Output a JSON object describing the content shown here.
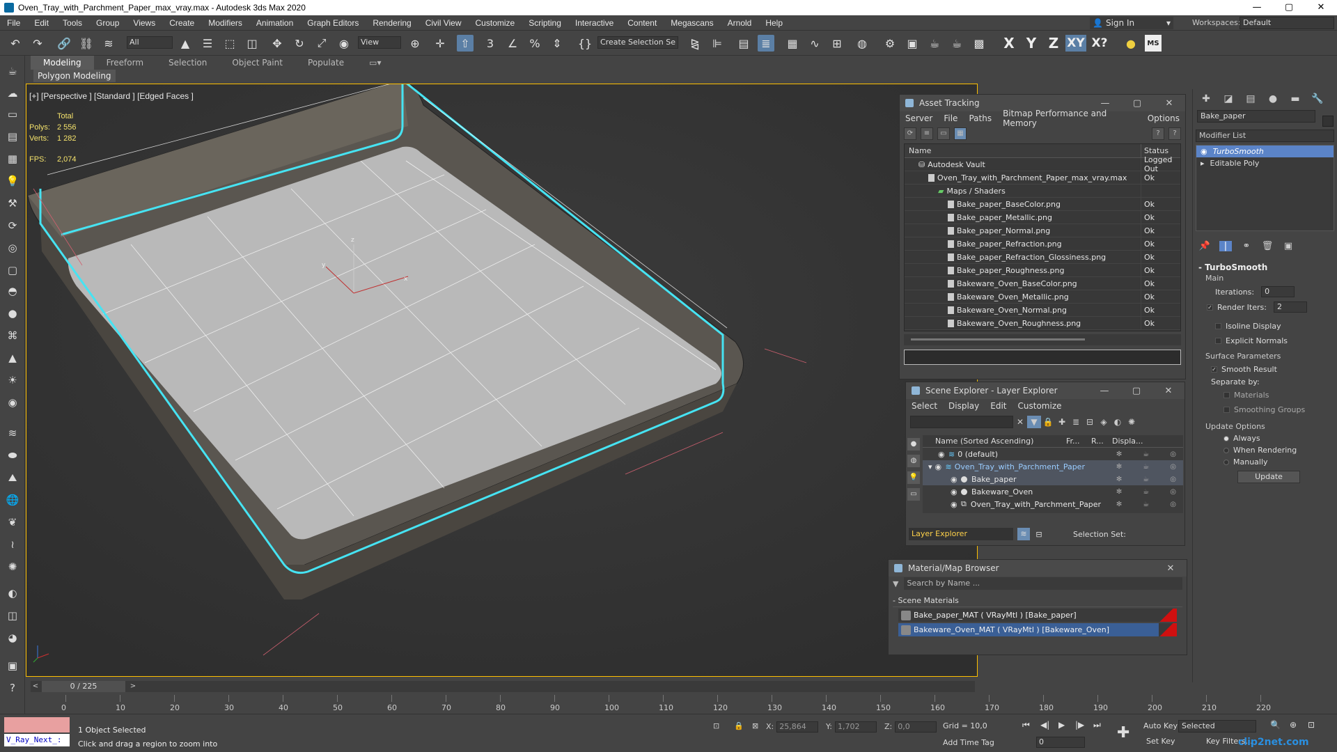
{
  "window": {
    "title": "Oven_Tray_with_Parchment_Paper_max_vray.max - Autodesk 3ds Max 2020",
    "controls": [
      "—",
      "▢",
      "✕"
    ]
  },
  "menu": {
    "items": [
      "File",
      "Edit",
      "Tools",
      "Group",
      "Views",
      "Create",
      "Modifiers",
      "Animation",
      "Graph Editors",
      "Rendering",
      "Civil View",
      "Customize",
      "Scripting",
      "Interactive",
      "Content",
      "Megascans",
      "Arnold",
      "Help"
    ],
    "sign_in": "Sign In",
    "workspaces_label": "Workspaces:",
    "workspace_value": "Default"
  },
  "toolbar": {
    "selection_filter": "All",
    "ref_coord": "View",
    "create_selection_set": "Create Selection Se",
    "axis_x": "X",
    "axis_y": "Y",
    "axis_z": "Z",
    "axis_xy": "XY",
    "axis_xq": "X?",
    "ms_label": "MS"
  },
  "ribbon": {
    "tabs": [
      "Modeling",
      "Freeform",
      "Selection",
      "Object Paint",
      "Populate"
    ],
    "sub_label": "Polygon Modeling"
  },
  "viewport": {
    "label": "[+] [Perspective ] [Standard ] [Edged Faces ]",
    "stats": {
      "total_label": "Total",
      "polys_label": "Polys:",
      "polys_value": "2 556",
      "verts_label": "Verts:",
      "verts_value": "1 282",
      "fps_label": "FPS:",
      "fps_value": "2,074"
    },
    "axis_x": "x",
    "axis_y": "y",
    "axis_z": "z"
  },
  "asset_tracking": {
    "title": "Asset Tracking",
    "menu": [
      "Server",
      "File",
      "Paths",
      "Bitmap Performance and Memory",
      "Options"
    ],
    "col_name": "Name",
    "col_status": "Status",
    "rows": [
      {
        "name": "Autodesk Vault",
        "status": "Logged Out"
      },
      {
        "name": "Oven_Tray_with_Parchment_Paper_max_vray.max",
        "status": "Ok"
      },
      {
        "name": "Maps / Shaders",
        "status": ""
      },
      {
        "name": "Bake_paper_BaseColor.png",
        "status": "Ok"
      },
      {
        "name": "Bake_paper_Metallic.png",
        "status": "Ok"
      },
      {
        "name": "Bake_paper_Normal.png",
        "status": "Ok"
      },
      {
        "name": "Bake_paper_Refraction.png",
        "status": "Ok"
      },
      {
        "name": "Bake_paper_Refraction_Glossiness.png",
        "status": "Ok"
      },
      {
        "name": "Bake_paper_Roughness.png",
        "status": "Ok"
      },
      {
        "name": "Bakeware_Oven_BaseColor.png",
        "status": "Ok"
      },
      {
        "name": "Bakeware_Oven_Metallic.png",
        "status": "Ok"
      },
      {
        "name": "Bakeware_Oven_Normal.png",
        "status": "Ok"
      },
      {
        "name": "Bakeware_Oven_Roughness.png",
        "status": "Ok"
      }
    ]
  },
  "scene_explorer": {
    "title": "Scene Explorer - Layer Explorer",
    "menu": [
      "Select",
      "Display",
      "Edit",
      "Customize"
    ],
    "col_name": "Name (Sorted Ascending)",
    "col_fr": "Fr...",
    "col_r": "R...",
    "col_disp": "Displa...",
    "rows": [
      {
        "name": "0 (default)"
      },
      {
        "name": "Oven_Tray_with_Parchment_Paper"
      },
      {
        "name": "Bake_paper"
      },
      {
        "name": "Bakeware_Oven"
      },
      {
        "name": "Oven_Tray_with_Parchment_Paper"
      }
    ],
    "layer_explorer": "Layer Explorer",
    "selection_set": "Selection Set:"
  },
  "material_browser": {
    "title": "Material/Map Browser",
    "search_placeholder": "Search by Name ...",
    "section": "- Scene Materials",
    "materials": [
      "Bake_paper_MAT ( VRayMtl ) [Bake_paper]",
      "Bakeware_Oven_MAT ( VRayMtl ) [Bakeware_Oven]"
    ]
  },
  "command_panel": {
    "object_name": "Bake_paper",
    "modifier_list": "Modifier List",
    "stack": [
      "TurboSmooth",
      "Editable Poly"
    ],
    "rollout_title": "TurboSmooth",
    "main_label": "Main",
    "iterations_label": "Iterations:",
    "iterations_value": "0",
    "render_iters_label": "Render Iters:",
    "render_iters_value": "2",
    "isoline_display": "Isoline Display",
    "explicit_normals": "Explicit Normals",
    "surface_params": "Surface Parameters",
    "smooth_result": "Smooth Result",
    "separate_by": "Separate by:",
    "materials": "Materials",
    "smoothing_groups": "Smoothing Groups",
    "update_options": "Update Options",
    "always": "Always",
    "when_rendering": "When Rendering",
    "manually": "Manually",
    "update_button": "Update"
  },
  "timeline": {
    "frame_display": "0 / 225",
    "ticks": [
      "0",
      "10",
      "20",
      "30",
      "40",
      "50",
      "60",
      "70",
      "80",
      "90",
      "100",
      "110",
      "120",
      "130",
      "140",
      "150",
      "160",
      "170",
      "180",
      "190",
      "200",
      "210",
      "220"
    ]
  },
  "status": {
    "script_text": "V_Ray_Next_:",
    "selected": "1 Object Selected",
    "prompt": "Click and drag a region to zoom into",
    "x_label": "X:",
    "x_value": "25,864",
    "y_label": "Y:",
    "y_value": "1,702",
    "z_label": "Z:",
    "z_value": "0,0",
    "grid": "Grid = 10,0",
    "add_time_tag": "Add Time Tag",
    "auto_key": "Auto Key",
    "set_key": "Set Key",
    "selected_dropdown": "Selected",
    "key_filters": "Key Filters...",
    "frame_value": "0",
    "watermark": "clip2net.com"
  }
}
